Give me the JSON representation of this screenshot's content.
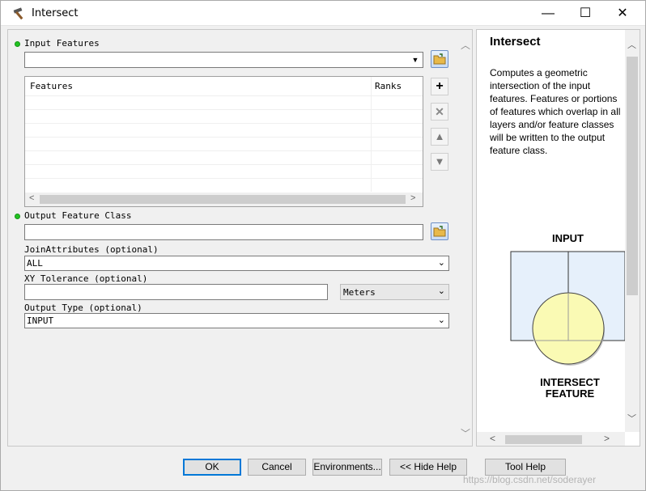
{
  "window": {
    "title": "Intersect",
    "minimize": "—",
    "maximize": "☐",
    "close": "✕"
  },
  "params": {
    "input_features_label": "Input Features",
    "input_features_value": "",
    "grid_col_features": "Features",
    "grid_col_ranks": "Ranks",
    "output_class_label": "Output Feature Class",
    "output_class_value": "",
    "join_label": "JoinAttributes (optional)",
    "join_value": "ALL",
    "xy_label": "XY Tolerance (optional)",
    "xy_value": "",
    "xy_units": "Meters",
    "output_type_label": "Output Type (optional)",
    "output_type_value": "INPUT"
  },
  "help": {
    "title": "Intersect",
    "body": "Computes a geometric intersection of the input features. Features or portions of features which overlap in all layers and/or feature classes will be written to the output feature class.",
    "diagram_top": "INPUT",
    "diagram_bottom_1": "INTERSECT",
    "diagram_bottom_2": "FEATURE"
  },
  "buttons": {
    "ok": "OK",
    "cancel": "Cancel",
    "environments": "Environments...",
    "hide_help": "<< Hide Help",
    "tool_help": "Tool Help"
  },
  "watermark": "https://blog.csdn.net/soderayer",
  "colors": {
    "required_dot": "#22c322",
    "diagram_fill": "#e6f0fb",
    "circle_fill": "#fafab4"
  }
}
